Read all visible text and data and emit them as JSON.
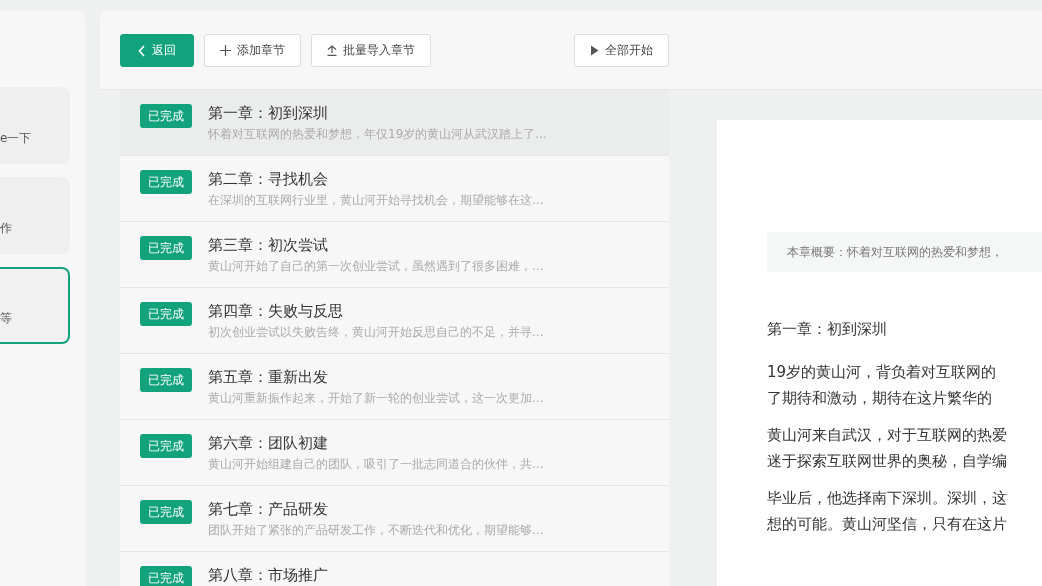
{
  "sidebar": {
    "items": [
      {
        "text": "e一下",
        "selected": false
      },
      {
        "text": "作",
        "selected": false
      },
      {
        "text": "等",
        "selected": true
      }
    ]
  },
  "toolbar": {
    "buttons": [
      {
        "kind": "back",
        "label": "返回"
      },
      {
        "kind": "add",
        "label": "添加章节"
      },
      {
        "kind": "import",
        "label": "批量导入章节"
      },
      {
        "kind": "play",
        "label": "全部开始"
      }
    ]
  },
  "chapters": [
    {
      "status": "已完成",
      "title": "第一章：初到深圳",
      "summary": "怀着对互联网的热爱和梦想，年仅19岁的黄山河从武汉踏上了...",
      "selected": true
    },
    {
      "status": "已完成",
      "title": "第二章：寻找机会",
      "summary": "在深圳的互联网行业里，黄山河开始寻找机会，期望能够在这...",
      "selected": false
    },
    {
      "status": "已完成",
      "title": "第三章：初次尝试",
      "summary": "黄山河开始了自己的第一次创业尝试，虽然遇到了很多困难，...",
      "selected": false
    },
    {
      "status": "已完成",
      "title": "第四章：失败与反思",
      "summary": "初次创业尝试以失败告终，黄山河开始反思自己的不足，并寻...",
      "selected": false
    },
    {
      "status": "已完成",
      "title": "第五章：重新出发",
      "summary": "黄山河重新振作起来，开始了新一轮的创业尝试，这一次更加...",
      "selected": false
    },
    {
      "status": "已完成",
      "title": "第六章：团队初建",
      "summary": "黄山河开始组建自己的团队，吸引了一批志同道合的伙伴，共...",
      "selected": false
    },
    {
      "status": "已完成",
      "title": "第七章：产品研发",
      "summary": "团队开始了紧张的产品研发工作，不断迭代和优化，期望能够...",
      "selected": false
    },
    {
      "status": "已完成",
      "title": "第八章：市场推广",
      "selected": false
    }
  ],
  "document": {
    "summary": "本章概要：怀着对互联网的热爱和梦想，",
    "heading": "第一章：初到深圳",
    "paragraphs": [
      {
        "lines": [
          "19岁的黄山河，背负着对互联网的",
          "了期待和激动，期待在这片繁华的"
        ]
      },
      {
        "lines": [
          "黄山河来自武汉，对于互联网的热爱",
          "迷于探索互联网世界的奥秘，自学编"
        ]
      },
      {
        "lines": [
          "毕业后，他选择南下深圳。深圳，这",
          "想的可能。黄山河坚信，只有在这片"
        ]
      }
    ]
  }
}
